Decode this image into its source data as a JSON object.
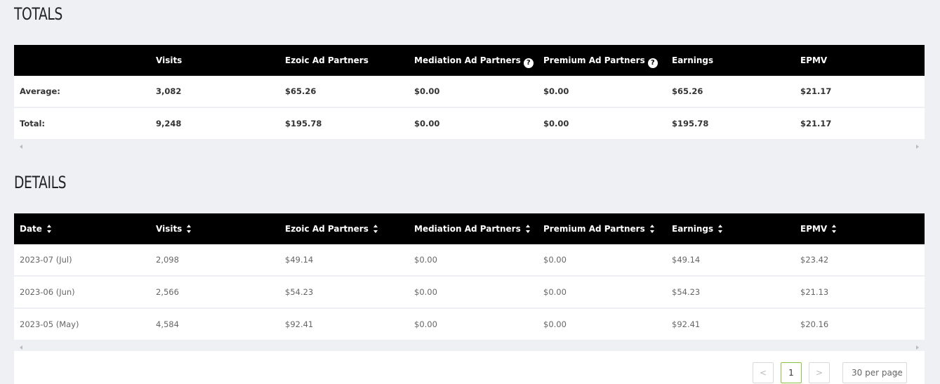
{
  "totals": {
    "title": "TOTALS",
    "headers": [
      "",
      "Visits",
      "Ezoic Ad Partners",
      "Mediation Ad Partners",
      "Premium Ad Partners",
      "Earnings",
      "EPMV"
    ],
    "rows": [
      [
        "Average:",
        "3,082",
        "$65.26",
        "$0.00",
        "$0.00",
        "$65.26",
        "$21.17"
      ],
      [
        "Total:",
        "9,248",
        "$195.78",
        "$0.00",
        "$0.00",
        "$195.78",
        "$21.17"
      ]
    ],
    "help_icon": "?"
  },
  "details": {
    "title": "DETAILS",
    "headers": [
      "Date",
      "Visits",
      "Ezoic Ad Partners",
      "Mediation Ad Partners",
      "Premium Ad Partners",
      "Earnings",
      "EPMV"
    ],
    "rows": [
      [
        "2023-07 (Jul)",
        "2,098",
        "$49.14",
        "$0.00",
        "$0.00",
        "$49.14",
        "$23.42"
      ],
      [
        "2023-06 (Jun)",
        "2,566",
        "$54.23",
        "$0.00",
        "$0.00",
        "$54.23",
        "$21.13"
      ],
      [
        "2023-05 (May)",
        "4,584",
        "$92.41",
        "$0.00",
        "$0.00",
        "$92.41",
        "$20.16"
      ]
    ]
  },
  "pagination": {
    "prev": "<",
    "current": "1",
    "next": ">",
    "page_size": "30 per page"
  },
  "colors": {
    "header_bg": "#000000",
    "page_bg": "#eef0f3",
    "active_page_border": "#8bc34a"
  }
}
